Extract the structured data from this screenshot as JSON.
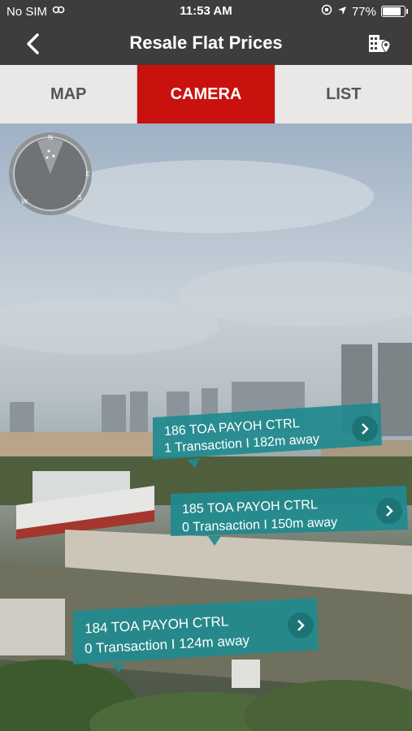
{
  "status": {
    "carrier": "No SIM",
    "time": "11:53 AM",
    "battery": "77%",
    "battery_level": 0.77
  },
  "nav": {
    "title": "Resale Flat Prices"
  },
  "tabs": [
    {
      "label": "MAP",
      "active": false
    },
    {
      "label": "CAMERA",
      "active": true
    },
    {
      "label": "LIST",
      "active": false
    }
  ],
  "radar": {
    "n": "N",
    "e": "E",
    "s": "S",
    "w": "W"
  },
  "pois": [
    {
      "title": "186 TOA PAYOH CTRL",
      "info": "1 Transaction I 182m away"
    },
    {
      "title": "185 TOA PAYOH CTRL",
      "info": "0 Transaction I 150m away"
    },
    {
      "title": "184 TOA PAYOH CTRL",
      "info": "0 Transaction I 124m away"
    }
  ],
  "colors": {
    "bar": "#3d3d3d",
    "accent": "#c9110d",
    "poi": "#1f8a8e"
  }
}
